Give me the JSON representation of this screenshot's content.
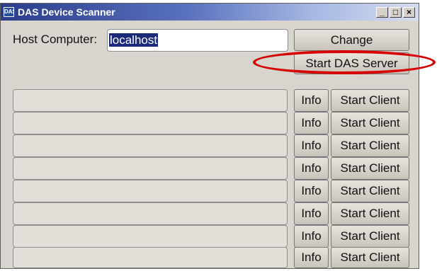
{
  "window": {
    "title": "DAS Device Scanner",
    "icon_text": "DAS",
    "controls": [
      "_",
      "□",
      "×"
    ]
  },
  "host": {
    "label": "Host Computer:",
    "value": "localhost"
  },
  "buttons": {
    "change": "Change",
    "start_das_server": "Start DAS Server"
  },
  "device_rows": [
    {
      "info": "Info",
      "start_client": "Start Client"
    },
    {
      "info": "Info",
      "start_client": "Start Client"
    },
    {
      "info": "Info",
      "start_client": "Start Client"
    },
    {
      "info": "Info",
      "start_client": "Start Client"
    },
    {
      "info": "Info",
      "start_client": "Start Client"
    },
    {
      "info": "Info",
      "start_client": "Start Client"
    },
    {
      "info": "Info",
      "start_client": "Start Client"
    },
    {
      "info": "Info",
      "start_client": "Start Client"
    }
  ],
  "annotation_color": "#d60000"
}
